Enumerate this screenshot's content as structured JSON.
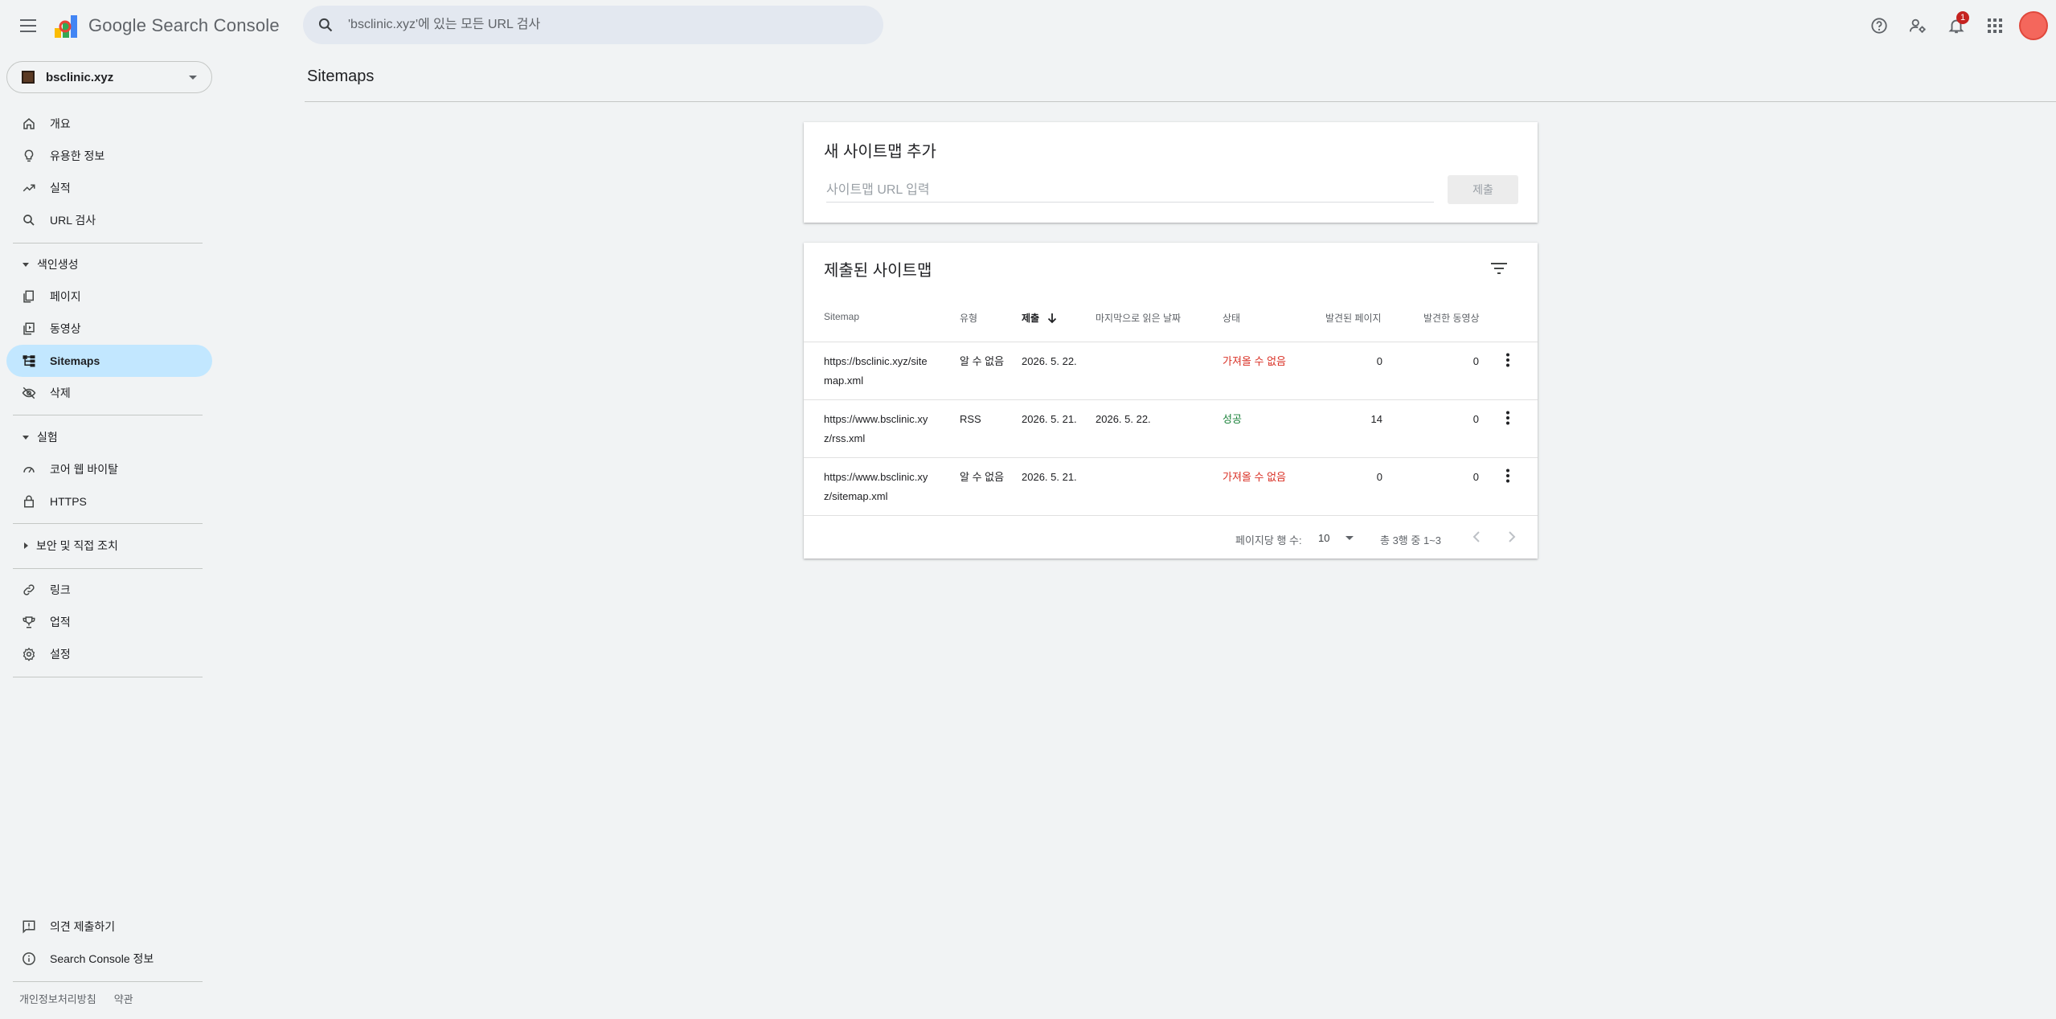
{
  "header": {
    "app_name": "Google Search Console",
    "search_placeholder": "'bsclinic.xyz'에 있는 모든 URL 검사",
    "notification_count": "1"
  },
  "sidebar": {
    "property": "bsclinic.xyz",
    "items_top": [
      {
        "label": "개요",
        "icon": "home-icon"
      },
      {
        "label": "유용한 정보",
        "icon": "lightbulb-icon"
      },
      {
        "label": "실적",
        "icon": "trending-up-icon"
      },
      {
        "label": "URL 검사",
        "icon": "search-icon"
      }
    ],
    "section_indexing": "색인생성",
    "items_indexing": [
      {
        "label": "페이지",
        "icon": "pages-icon"
      },
      {
        "label": "동영상",
        "icon": "video-pages-icon"
      },
      {
        "label": "Sitemaps",
        "icon": "sitemap-icon"
      },
      {
        "label": "삭제",
        "icon": "removal-icon"
      }
    ],
    "section_experience": "실험",
    "items_experience": [
      {
        "label": "코어 웹 바이탈",
        "icon": "speed-icon"
      },
      {
        "label": "HTTPS",
        "icon": "lock-icon"
      }
    ],
    "section_security": "보안 및 직접 조치",
    "items_bottom": [
      {
        "label": "링크",
        "icon": "link-icon"
      },
      {
        "label": "업적",
        "icon": "trophy-icon"
      },
      {
        "label": "설정",
        "icon": "gear-icon"
      }
    ],
    "footer_items": [
      {
        "label": "의견 제출하기",
        "icon": "feedback-icon"
      },
      {
        "label": "Search Console 정보",
        "icon": "info-icon"
      }
    ],
    "footer_links": [
      "개인정보처리방침",
      "약관"
    ]
  },
  "main": {
    "title": "Sitemaps",
    "add_card": {
      "title": "새 사이트맵 추가",
      "input_placeholder": "사이트맵 URL 입력",
      "submit_label": "제출"
    },
    "list_card": {
      "title": "제출된 사이트맵",
      "columns": [
        "Sitemap",
        "유형",
        "제출",
        "마지막으로 읽은 날짜",
        "상태",
        "발견된 페이지",
        "발견한 동영상"
      ],
      "rows": [
        {
          "sitemap": [
            "https://bsclinic.xyz/site",
            "map.xml"
          ],
          "type": "알 수 없음",
          "submitted": "2026. 5. 22.",
          "last_read": "",
          "status": "가져올 수 없음",
          "status_kind": "error",
          "pages": "0",
          "videos": "0"
        },
        {
          "sitemap": [
            "https://www.bsclinic.xy",
            "z/rss.xml"
          ],
          "type": "RSS",
          "submitted": "2026. 5. 21.",
          "last_read": "2026. 5. 22.",
          "status": "성공",
          "status_kind": "ok",
          "pages": "14",
          "videos": "0"
        },
        {
          "sitemap": [
            "https://www.bsclinic.xy",
            "z/sitemap.xml"
          ],
          "type": "알 수 없음",
          "submitted": "2026. 5. 21.",
          "last_read": "",
          "status": "가져올 수 없음",
          "status_kind": "error",
          "pages": "0",
          "videos": "0"
        }
      ],
      "pager": {
        "rows_per_page_label": "페이지당 행 수:",
        "rows_per_page": "10",
        "range": "총 3행 중 1~3"
      }
    }
  },
  "colors": {
    "active_nav": "#c2e7ff",
    "error": "#d93025",
    "success": "#188038",
    "background": "#f1f3f4"
  }
}
